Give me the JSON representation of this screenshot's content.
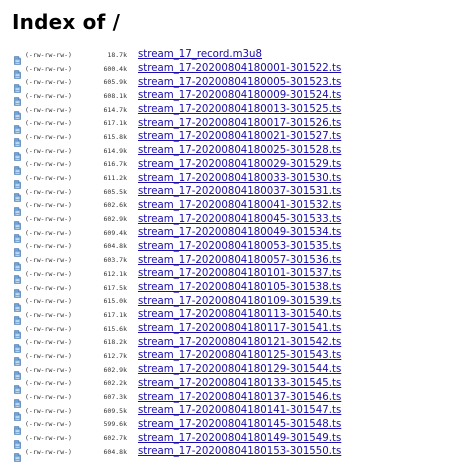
{
  "page": {
    "title": "Index of /"
  },
  "icons": {
    "file": "file-icon"
  },
  "colors": {
    "link": "#1a0dab",
    "icon_fill": "#6fa4d8"
  },
  "files": [
    {
      "perms": "(-rw-rw-rw-)",
      "size": "18.7k",
      "name": "stream_17_record.m3u8"
    },
    {
      "perms": "(-rw-rw-rw-)",
      "size": "600.4k",
      "name": "stream_17-20200804180001-301522.ts"
    },
    {
      "perms": "(-rw-rw-rw-)",
      "size": "605.9k",
      "name": "stream_17-20200804180005-301523.ts"
    },
    {
      "perms": "(-rw-rw-rw-)",
      "size": "608.1k",
      "name": "stream_17-20200804180009-301524.ts"
    },
    {
      "perms": "(-rw-rw-rw-)",
      "size": "614.7k",
      "name": "stream_17-20200804180013-301525.ts"
    },
    {
      "perms": "(-rw-rw-rw-)",
      "size": "617.1k",
      "name": "stream_17-20200804180017-301526.ts"
    },
    {
      "perms": "(-rw-rw-rw-)",
      "size": "615.8k",
      "name": "stream_17-20200804180021-301527.ts"
    },
    {
      "perms": "(-rw-rw-rw-)",
      "size": "614.9k",
      "name": "stream_17-20200804180025-301528.ts"
    },
    {
      "perms": "(-rw-rw-rw-)",
      "size": "616.7k",
      "name": "stream_17-20200804180029-301529.ts"
    },
    {
      "perms": "(-rw-rw-rw-)",
      "size": "611.2k",
      "name": "stream_17-20200804180033-301530.ts"
    },
    {
      "perms": "(-rw-rw-rw-)",
      "size": "605.5k",
      "name": "stream_17-20200804180037-301531.ts"
    },
    {
      "perms": "(-rw-rw-rw-)",
      "size": "602.6k",
      "name": "stream_17-20200804180041-301532.ts"
    },
    {
      "perms": "(-rw-rw-rw-)",
      "size": "602.9k",
      "name": "stream_17-20200804180045-301533.ts"
    },
    {
      "perms": "(-rw-rw-rw-)",
      "size": "609.4k",
      "name": "stream_17-20200804180049-301534.ts"
    },
    {
      "perms": "(-rw-rw-rw-)",
      "size": "604.8k",
      "name": "stream_17-20200804180053-301535.ts"
    },
    {
      "perms": "(-rw-rw-rw-)",
      "size": "603.7k",
      "name": "stream_17-20200804180057-301536.ts"
    },
    {
      "perms": "(-rw-rw-rw-)",
      "size": "612.1k",
      "name": "stream_17-20200804180101-301537.ts"
    },
    {
      "perms": "(-rw-rw-rw-)",
      "size": "617.5k",
      "name": "stream_17-20200804180105-301538.ts"
    },
    {
      "perms": "(-rw-rw-rw-)",
      "size": "615.0k",
      "name": "stream_17-20200804180109-301539.ts"
    },
    {
      "perms": "(-rw-rw-rw-)",
      "size": "617.1k",
      "name": "stream_17-20200804180113-301540.ts"
    },
    {
      "perms": "(-rw-rw-rw-)",
      "size": "615.6k",
      "name": "stream_17-20200804180117-301541.ts"
    },
    {
      "perms": "(-rw-rw-rw-)",
      "size": "618.2k",
      "name": "stream_17-20200804180121-301542.ts"
    },
    {
      "perms": "(-rw-rw-rw-)",
      "size": "612.7k",
      "name": "stream_17-20200804180125-301543.ts"
    },
    {
      "perms": "(-rw-rw-rw-)",
      "size": "602.9k",
      "name": "stream_17-20200804180129-301544.ts"
    },
    {
      "perms": "(-rw-rw-rw-)",
      "size": "602.2k",
      "name": "stream_17-20200804180133-301545.ts"
    },
    {
      "perms": "(-rw-rw-rw-)",
      "size": "607.3k",
      "name": "stream_17-20200804180137-301546.ts"
    },
    {
      "perms": "(-rw-rw-rw-)",
      "size": "609.5k",
      "name": "stream_17-20200804180141-301547.ts"
    },
    {
      "perms": "(-rw-rw-rw-)",
      "size": "599.6k",
      "name": "stream_17-20200804180145-301548.ts"
    },
    {
      "perms": "(-rw-rw-rw-)",
      "size": "602.7k",
      "name": "stream_17-20200804180149-301549.ts"
    },
    {
      "perms": "(-rw-rw-rw-)",
      "size": "604.8k",
      "name": "stream_17-20200804180153-301550.ts"
    }
  ]
}
